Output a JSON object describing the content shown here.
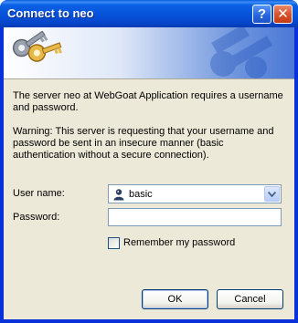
{
  "window": {
    "title": "Connect to neo"
  },
  "titlebar_buttons": {
    "help": "?",
    "close": "✕"
  },
  "banner": {
    "icon": "keys-icon"
  },
  "message": "The server neo at WebGoat Application requires a username and password.",
  "warning": "Warning: This server is requesting that your username and password be sent in an insecure manner (basic authentication without a secure connection).",
  "form": {
    "username_label": "User name:",
    "username_value": "basic",
    "password_label": "Password:",
    "password_value": "",
    "remember_label": "Remember my password",
    "remember_checked": false
  },
  "buttons": {
    "ok": "OK",
    "cancel": "Cancel"
  },
  "colors": {
    "titlebar": "#0652d8",
    "dialog_bg": "#ece9d8",
    "close_button": "#d9532e"
  }
}
